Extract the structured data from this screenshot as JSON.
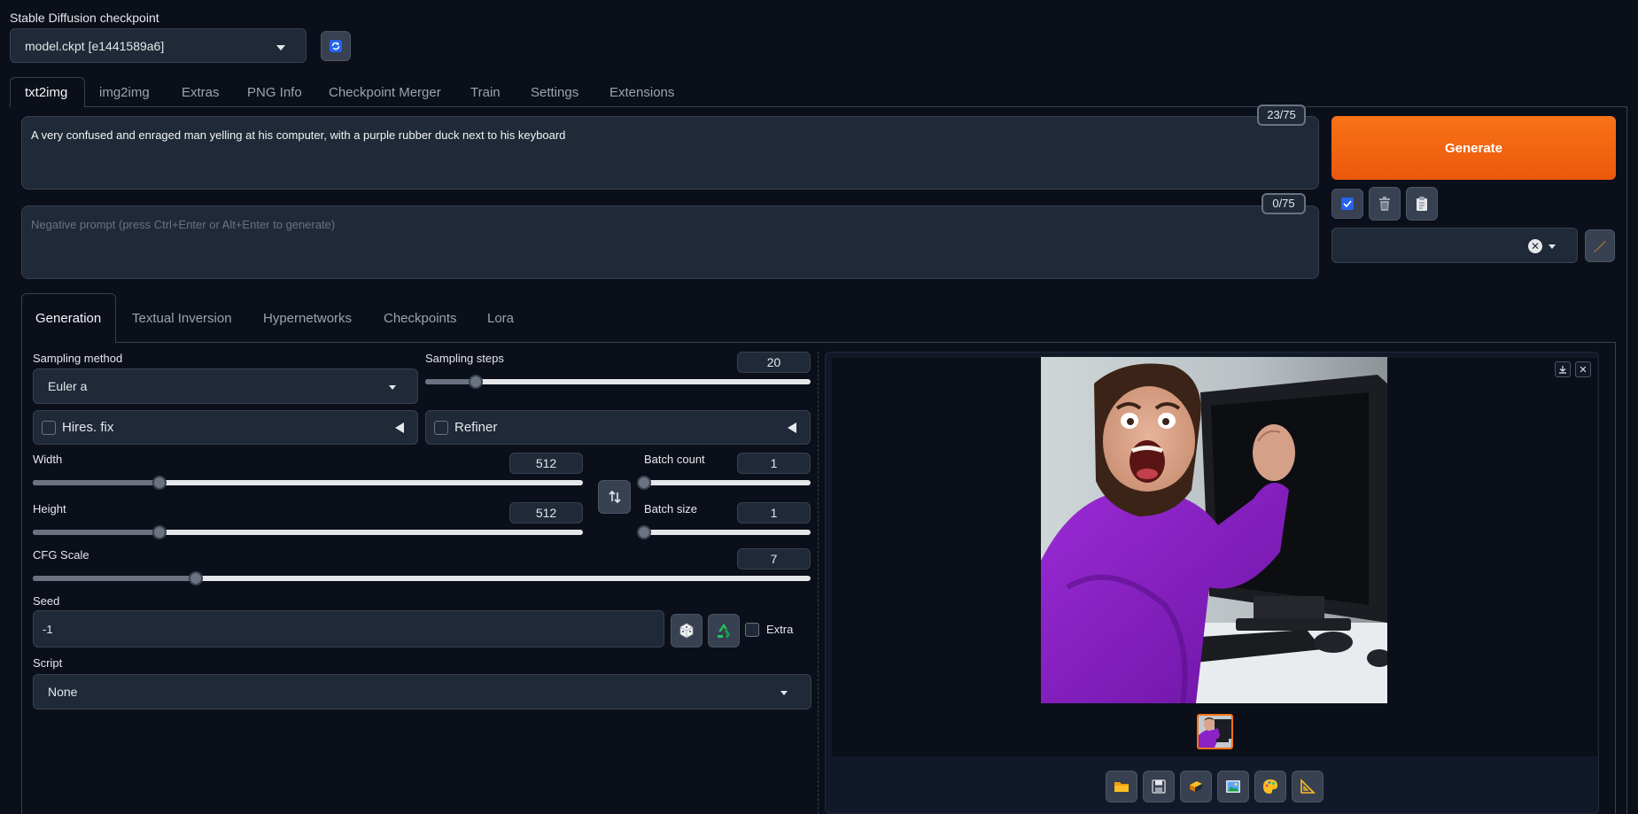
{
  "checkpoint": {
    "label": "Stable Diffusion checkpoint",
    "value": "model.ckpt [e1441589a6]"
  },
  "main_tabs": [
    "txt2img",
    "img2img",
    "Extras",
    "PNG Info",
    "Checkpoint Merger",
    "Train",
    "Settings",
    "Extensions"
  ],
  "prompt": {
    "text": "A very confused and enraged man yelling at his computer, with a purple rubber duck next to his keyboard",
    "token_count": "23/75"
  },
  "negative_prompt": {
    "placeholder": "Negative prompt (press Ctrl+Enter or Alt+Enter to generate)",
    "token_count": "0/75"
  },
  "generate_label": "Generate",
  "sub_tabs": [
    "Generation",
    "Textual Inversion",
    "Hypernetworks",
    "Checkpoints",
    "Lora"
  ],
  "sampling_method": {
    "label": "Sampling method",
    "value": "Euler a"
  },
  "sampling_steps": {
    "label": "Sampling steps",
    "value": "20",
    "fraction": 0.13
  },
  "hires_fix": {
    "label": "Hires. fix"
  },
  "refiner": {
    "label": "Refiner"
  },
  "width": {
    "label": "Width",
    "value": "512",
    "fraction": 0.23
  },
  "height": {
    "label": "Height",
    "value": "512",
    "fraction": 0.23
  },
  "batch_count": {
    "label": "Batch count",
    "value": "1",
    "fraction": 0.0
  },
  "batch_size": {
    "label": "Batch size",
    "value": "1",
    "fraction": 0.0
  },
  "cfg_scale": {
    "label": "CFG Scale",
    "value": "7",
    "fraction": 0.21
  },
  "seed": {
    "label": "Seed",
    "value": "-1",
    "extra_label": "Extra"
  },
  "script": {
    "label": "Script",
    "value": "None"
  },
  "colors": {
    "accent": "#f97316",
    "background": "#0b0f19",
    "panel": "#1f2937"
  }
}
